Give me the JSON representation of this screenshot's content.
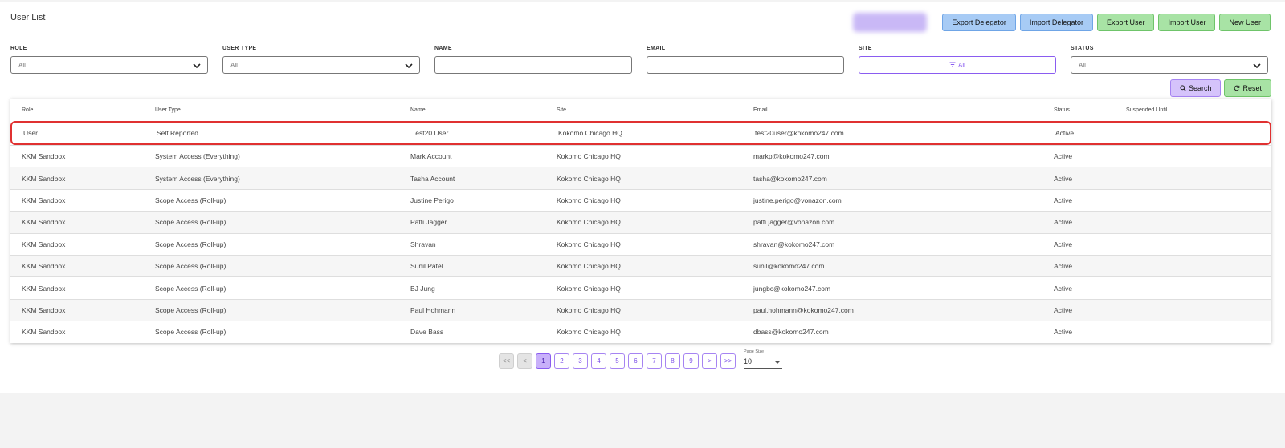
{
  "page": {
    "title": "User List"
  },
  "header_buttons": {
    "export_delegator": "Export Delegator",
    "import_delegator": "Import Delegator",
    "export_user": "Export User",
    "import_user": "Import User",
    "new_user": "New User"
  },
  "filters": {
    "role": {
      "label": "ROLE",
      "value": "All"
    },
    "user_type": {
      "label": "USER TYPE",
      "value": "All"
    },
    "name": {
      "label": "NAME",
      "value": ""
    },
    "email": {
      "label": "EMAIL",
      "value": ""
    },
    "site": {
      "label": "SITE",
      "value": "All"
    },
    "status": {
      "label": "STATUS",
      "value": "All"
    }
  },
  "actions": {
    "search": "Search",
    "reset": "Reset"
  },
  "table": {
    "columns": [
      "Role",
      "User Type",
      "Name",
      "Site",
      "Email",
      "Status",
      "Suspended Until"
    ],
    "rows": [
      [
        "User",
        "Self Reported",
        "Test20 User",
        "Kokomo Chicago HQ",
        "test20user@kokomo247.com",
        "Active",
        ""
      ],
      [
        "KKM Sandbox",
        "System Access (Everything)",
        "Mark Account",
        "Kokomo Chicago HQ",
        "markp@kokomo247.com",
        "Active",
        ""
      ],
      [
        "KKM Sandbox",
        "System Access (Everything)",
        "Tasha Account",
        "Kokomo Chicago HQ",
        "tasha@kokomo247.com",
        "Active",
        ""
      ],
      [
        "KKM Sandbox",
        "Scope Access (Roll-up)",
        "Justine Perigo",
        "Kokomo Chicago HQ",
        "justine.perigo@vonazon.com",
        "Active",
        ""
      ],
      [
        "KKM Sandbox",
        "Scope Access (Roll-up)",
        "Patti Jagger",
        "Kokomo Chicago HQ",
        "patti.jagger@vonazon.com",
        "Active",
        ""
      ],
      [
        "KKM Sandbox",
        "Scope Access (Roll-up)",
        "Shravan",
        "Kokomo Chicago HQ",
        "shravan@kokomo247.com",
        "Active",
        ""
      ],
      [
        "KKM Sandbox",
        "Scope Access (Roll-up)",
        "Sunil Patel",
        "Kokomo Chicago HQ",
        "sunil@kokomo247.com",
        "Active",
        ""
      ],
      [
        "KKM Sandbox",
        "Scope Access (Roll-up)",
        "BJ Jung",
        "Kokomo Chicago HQ",
        "jungbc@kokomo247.com",
        "Active",
        ""
      ],
      [
        "KKM Sandbox",
        "Scope Access (Roll-up)",
        "Paul Hohmann",
        "Kokomo Chicago HQ",
        "paul.hohmann@kokomo247.com",
        "Active",
        ""
      ],
      [
        "KKM Sandbox",
        "Scope Access (Roll-up)",
        "Dave Bass",
        "Kokomo Chicago HQ",
        "dbass@kokomo247.com",
        "Active",
        ""
      ]
    ]
  },
  "pagination": {
    "first": "<<",
    "prev": "<",
    "pages": [
      "1",
      "2",
      "3",
      "4",
      "5",
      "6",
      "7",
      "8",
      "9"
    ],
    "current": "1",
    "next": ">",
    "last": ">>",
    "page_size_label": "Page Size",
    "page_size_value": "10"
  },
  "colors": {
    "accent_purple": "#8a5cf0",
    "button_blue": "#a7cbf5",
    "button_green": "#a8e3a5",
    "highlight_red": "#e03131"
  }
}
